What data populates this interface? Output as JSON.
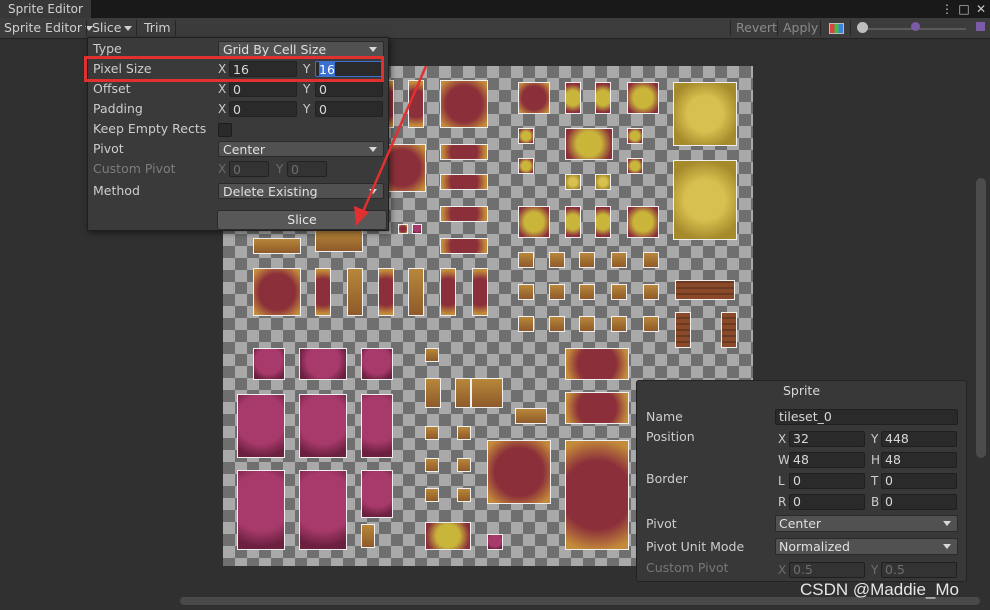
{
  "window": {
    "tab_title": "Sprite Editor"
  },
  "toolbar": {
    "mode_label": "Sprite Editor",
    "slice_label": "Slice",
    "trim_label": "Trim",
    "revert_label": "Revert",
    "apply_label": "Apply"
  },
  "slice_panel": {
    "type": {
      "label": "Type",
      "value": "Grid By Cell Size"
    },
    "pixel_size": {
      "label": "Pixel Size",
      "x_axis": "X",
      "x": "16",
      "y_axis": "Y",
      "y": "16"
    },
    "offset": {
      "label": "Offset",
      "x_axis": "X",
      "x": "0",
      "y_axis": "Y",
      "y": "0"
    },
    "padding": {
      "label": "Padding",
      "x_axis": "X",
      "x": "0",
      "y_axis": "Y",
      "y": "0"
    },
    "keep_empty_rects": {
      "label": "Keep Empty Rects",
      "checked": false
    },
    "pivot": {
      "label": "Pivot",
      "value": "Center"
    },
    "custom_pivot": {
      "label": "Custom Pivot",
      "x_axis": "X",
      "x": "0",
      "y_axis": "Y",
      "y": "0"
    },
    "method": {
      "label": "Method",
      "value": "Delete Existing"
    },
    "slice_button": "Slice"
  },
  "sprite_panel": {
    "title": "Sprite",
    "name": {
      "label": "Name",
      "value": "tileset_0"
    },
    "position": {
      "label": "Position",
      "x": "32",
      "y": "448",
      "w": "48",
      "h": "48"
    },
    "axes": {
      "x": "X",
      "y": "Y",
      "w": "W",
      "h": "H",
      "l": "L",
      "t": "T",
      "r": "R",
      "b": "B"
    },
    "border": {
      "label": "Border",
      "l": "0",
      "t": "0",
      "r": "0",
      "b": "0"
    },
    "pivot": {
      "label": "Pivot",
      "value": "Center"
    },
    "pivot_unit_mode": {
      "label": "Pivot Unit Mode",
      "value": "Normalized"
    },
    "custom_pivot": {
      "label": "Custom Pivot",
      "x": "0.5",
      "y": "0.5"
    }
  },
  "watermark": "CSDN @Maddie_Mo",
  "colors": {
    "highlight": "#e03030",
    "selection": "#3b6fd0"
  }
}
